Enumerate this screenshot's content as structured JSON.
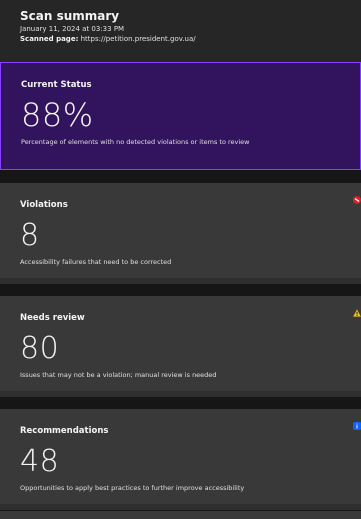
{
  "header": {
    "title": "Scan summary",
    "date": "January 11, 2024 at 03:33 PM",
    "scanned_label": "Scanned page:",
    "scanned_url": "https://petition.president.gov.ua/"
  },
  "current_status": {
    "title": "Current Status",
    "value": "88%",
    "description": "Percentage of elements with no detected violations or items to review"
  },
  "cards": {
    "violations": {
      "title": "Violations",
      "value": "8",
      "description": "Accessibility failures that need to be corrected",
      "icon": "violation-icon",
      "color": "#da1e28"
    },
    "needs_review": {
      "title": "Needs review",
      "value": "80",
      "description": "Issues that may not be a violation; manual review is needed",
      "icon": "warning-icon",
      "color": "#f1c21b"
    },
    "recommendations": {
      "title": "Recommendations",
      "value": "48",
      "description": "Opportunities to apply best practices to further improve accessibility",
      "icon": "info-icon",
      "color": "#0f62fe"
    }
  }
}
